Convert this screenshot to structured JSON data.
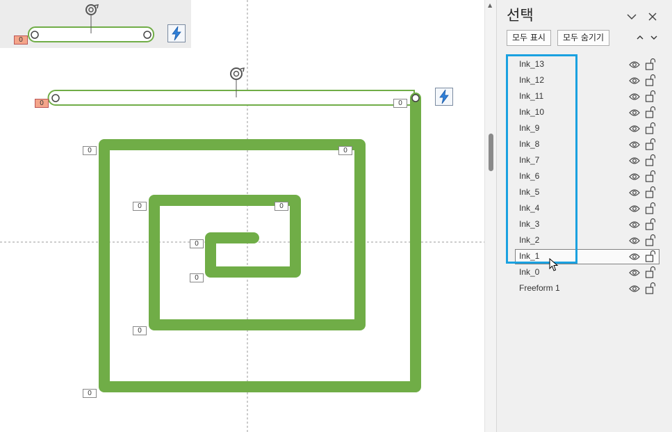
{
  "panel": {
    "title": "선택",
    "show_all_label": "모두 표시",
    "hide_all_label": "모두 숨기기",
    "items": [
      {
        "label": "Ink_13",
        "selected": false
      },
      {
        "label": "Ink_12",
        "selected": false
      },
      {
        "label": "Ink_11",
        "selected": false
      },
      {
        "label": "Ink_10",
        "selected": false
      },
      {
        "label": "Ink_9",
        "selected": false
      },
      {
        "label": "Ink_8",
        "selected": false
      },
      {
        "label": "Ink_7",
        "selected": false
      },
      {
        "label": "Ink_6",
        "selected": false
      },
      {
        "label": "Ink_5",
        "selected": false
      },
      {
        "label": "Ink_4",
        "selected": false
      },
      {
        "label": "Ink_3",
        "selected": false
      },
      {
        "label": "Ink_2",
        "selected": false
      },
      {
        "label": "Ink_1",
        "selected": true
      },
      {
        "label": "Ink_0",
        "selected": false
      },
      {
        "label": "Freeform 1",
        "selected": false
      }
    ]
  },
  "canvas": {
    "inset_badge": "0",
    "top_left_badge": "0",
    "top_right_badge": "0",
    "vertex_badges": [
      "0",
      "0",
      "0",
      "0",
      "0",
      "0",
      "0",
      "0"
    ]
  },
  "colors": {
    "ink": "#70ad47",
    "highlight": "#1aa1e0",
    "badge_red": "#f4a58a"
  },
  "icons": {
    "rotate": "rotate-handle-icon",
    "animation": "lightning-icon",
    "visibility": "eye-icon",
    "lock": "unlock-icon",
    "collapse": "chevron-down-icon",
    "close": "close-icon",
    "bring_forward": "triangle-up-icon",
    "send_backward": "triangle-down-icon",
    "pointer": "cursor-icon"
  }
}
